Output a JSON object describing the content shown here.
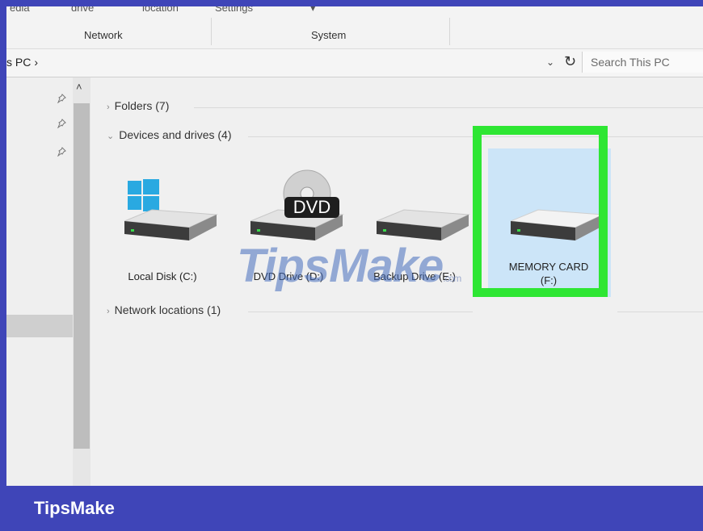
{
  "ribbon": {
    "cut_labels": [
      "edia",
      "drive",
      "location",
      "Settings",
      "▾"
    ],
    "groups": {
      "network": "Network",
      "system": "System"
    }
  },
  "address": {
    "crumb": "s PC",
    "chevron": "›",
    "dropdown_icon": "⌄",
    "refresh_icon": "↻",
    "search_placeholder": "Search This PC"
  },
  "nav": {
    "pin_icon": "📌",
    "scroll_up": "˄"
  },
  "sections": [
    {
      "label": "Folders (7)",
      "expanded": false
    },
    {
      "label": "Devices and drives (4)",
      "expanded": true
    },
    {
      "label": "Network locations (1)",
      "expanded": false
    }
  ],
  "drives": [
    {
      "label": "Local Disk (C:)",
      "icon": "windows-drive-icon"
    },
    {
      "label": "DVD Drive (D:)",
      "icon": "dvd-drive-icon",
      "badge": "DVD"
    },
    {
      "label": "Backup Drive (E:)",
      "icon": "hard-drive-icon"
    },
    {
      "label": "MEMORY CARD\n(F:)",
      "icon": "hard-drive-icon",
      "selected": true
    }
  ],
  "watermark": {
    "text": "TipsMake",
    "suffix": ".com"
  },
  "brand": "TipsMake",
  "colors": {
    "frame": "#3f45b8",
    "highlight": "#2ee633",
    "selection": "#cce5f8"
  }
}
